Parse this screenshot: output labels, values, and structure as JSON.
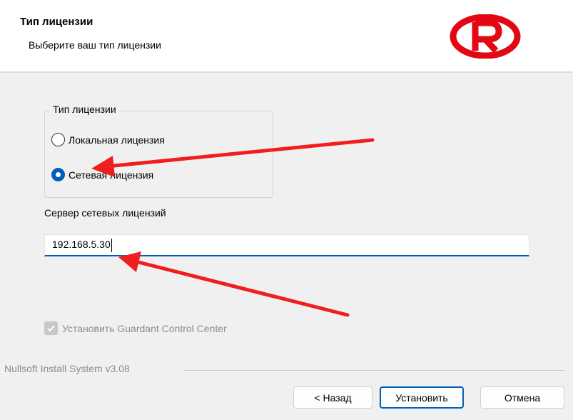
{
  "header": {
    "title": "Тип лицензии",
    "subtitle": "Выберите ваш тип лицензии",
    "logo_icon": "red-r-logo-icon",
    "logo_color": "#e30613"
  },
  "license_group": {
    "legend": "Тип лицензии",
    "options": [
      {
        "label": "Локальная лицензия",
        "selected": false
      },
      {
        "label": "Сетевая лицензия",
        "selected": true
      }
    ]
  },
  "server": {
    "label": "Сервер сетевых лицензий",
    "value": "192.168.5.30"
  },
  "install_gcc": {
    "label": "Установить Guardant Control Center",
    "checked": true,
    "disabled": true
  },
  "footer": {
    "branding": "Nullsoft Install System v3.08"
  },
  "buttons": {
    "back": "< Назад",
    "install": "Установить",
    "cancel": "Отмена"
  },
  "colors": {
    "accent": "#005fb8",
    "annotation_arrow": "#f01e1e"
  }
}
